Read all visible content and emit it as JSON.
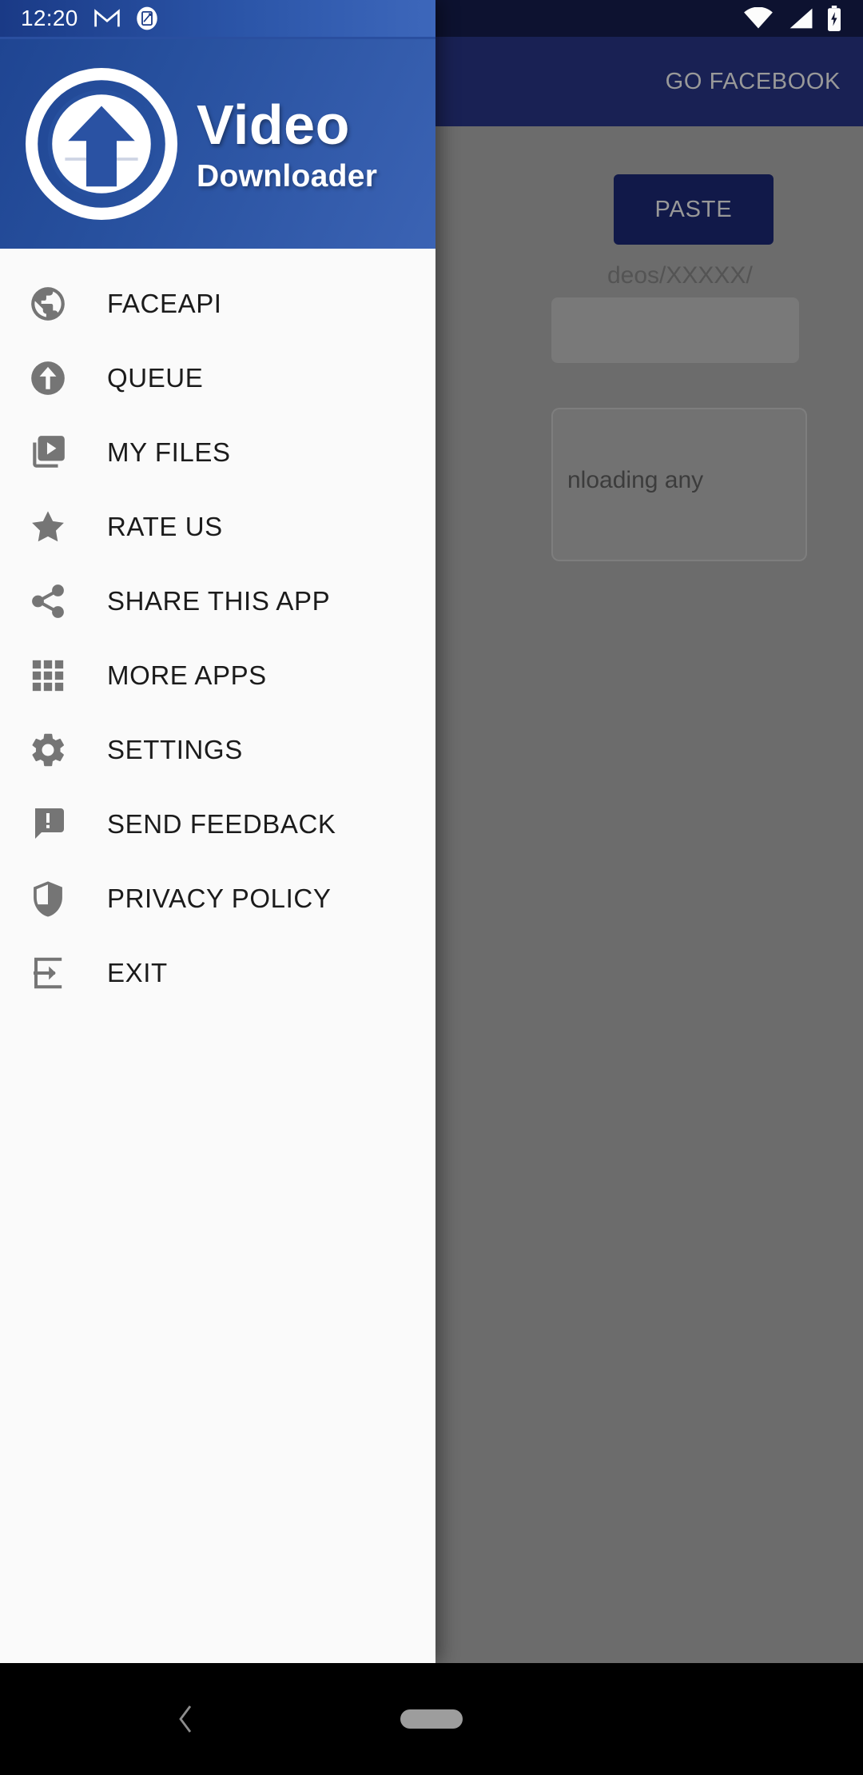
{
  "status_bar": {
    "clock": "12:20",
    "notification_icons": [
      "gmail-icon",
      "screenshot-icon"
    ],
    "system_icons": [
      "wifi-icon",
      "signal-icon",
      "battery-charging-icon"
    ]
  },
  "background_app": {
    "appbar": {
      "action_label": "GO FACEBOOK"
    },
    "paste_button": "PASTE",
    "url_hint": "deos/XXXXX/",
    "info_card_text": "nloading any"
  },
  "drawer": {
    "brand": {
      "title": "Video",
      "subtitle": "Downloader",
      "logo": "upload-circle-logo"
    },
    "items": [
      {
        "label": "FACEAPI",
        "icon": "globe-icon"
      },
      {
        "label": "QUEUE",
        "icon": "upload-circle-icon"
      },
      {
        "label": "MY FILES",
        "icon": "video-library-icon"
      },
      {
        "label": "RATE US",
        "icon": "star-icon"
      },
      {
        "label": "SHARE THIS APP",
        "icon": "share-icon"
      },
      {
        "label": "MORE APPS",
        "icon": "apps-grid-icon"
      },
      {
        "label": "SETTINGS",
        "icon": "gear-icon"
      },
      {
        "label": "SEND FEEDBACK",
        "icon": "feedback-bubble-icon"
      },
      {
        "label": "PRIVACY POLICY",
        "icon": "shield-icon"
      },
      {
        "label": "EXIT",
        "icon": "exit-arrow-icon"
      }
    ]
  },
  "nav_bar": {
    "back": "back-chevron-icon",
    "home": "home-pill-icon"
  },
  "colors": {
    "brand_blue": "#27509e",
    "appbar_dark": "#1a2255",
    "statusbar_dark": "#0e1331",
    "drawer_bg": "#fafafa",
    "icon_gray": "#757575",
    "label_dark": "#1b1b1b"
  }
}
